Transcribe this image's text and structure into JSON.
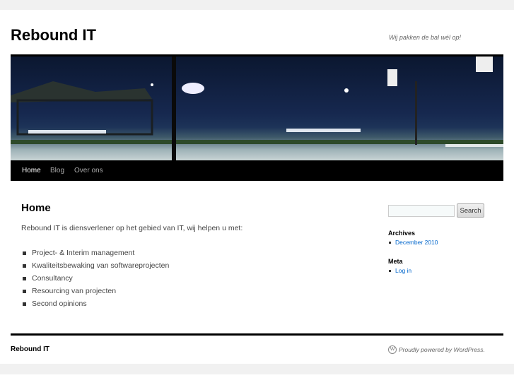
{
  "site": {
    "title": "Rebound IT",
    "tagline": "Wij pakken de bal wél op!"
  },
  "nav": [
    {
      "label": "Home",
      "active": true
    },
    {
      "label": "Blog"
    },
    {
      "label": "Over ons"
    }
  ],
  "page": {
    "title": "Home",
    "intro": "Rebound IT is diensverlener op het gebied van IT, wij helpen u met:",
    "items": [
      "Project- & Interim management",
      "Kwaliteitsbewaking van softwareprojecten",
      "Consultancy",
      "Resourcing van projecten",
      "Second opinions"
    ]
  },
  "sidebar": {
    "search_value": "",
    "search_label": "Search",
    "archives_title": "Archives",
    "archives": [
      "December 2010"
    ],
    "meta_title": "Meta",
    "meta": [
      "Log in"
    ]
  },
  "footer": {
    "name": "Rebound IT",
    "powered": "Proudly powered by WordPress."
  },
  "colors": {
    "link": "#0066cc",
    "nav_bg": "#000000"
  }
}
